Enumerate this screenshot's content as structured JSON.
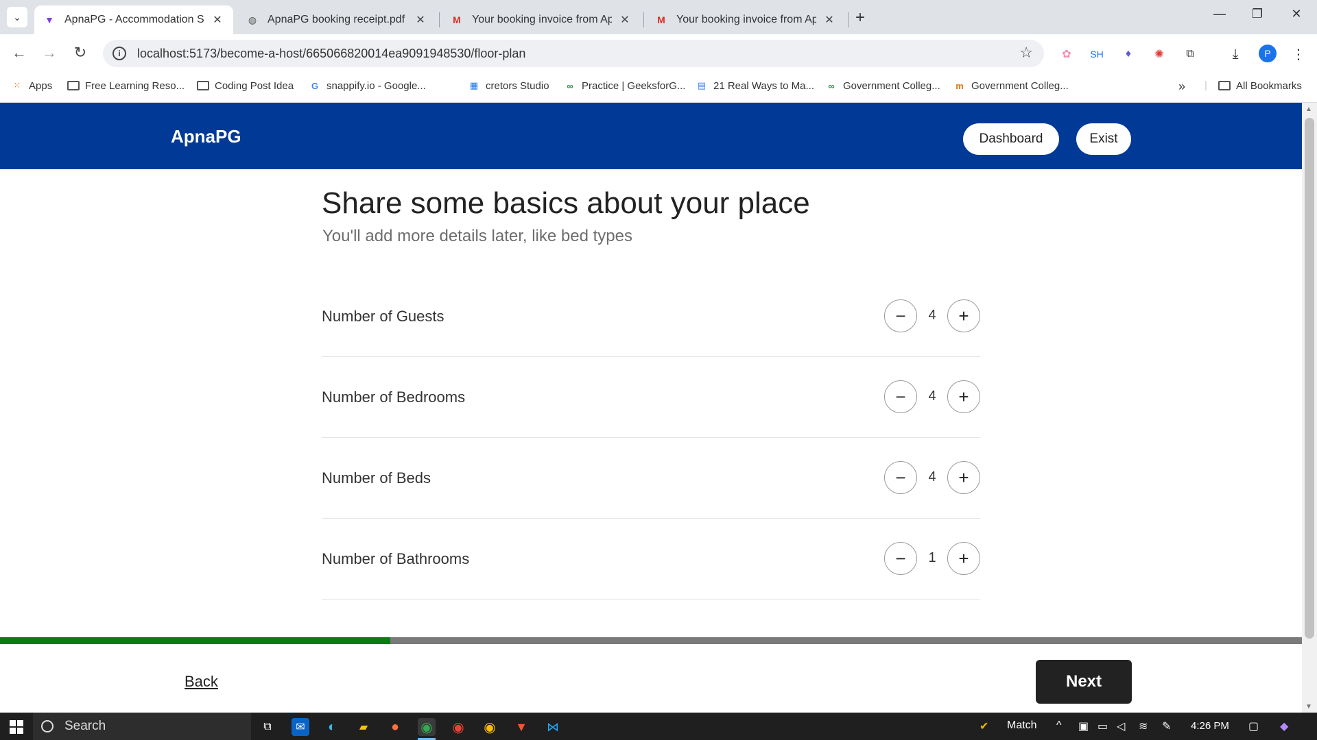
{
  "browser": {
    "tabs": [
      {
        "title": "ApnaPG - Accommodation Solu",
        "favicon": "apnapg-favicon",
        "active": true
      },
      {
        "title": "ApnaPG booking receipt.pdf",
        "favicon": "globe-icon",
        "active": false
      },
      {
        "title": "Your booking invoice from Apn",
        "favicon": "gmail-icon",
        "active": false
      },
      {
        "title": "Your booking invoice from Apn",
        "favicon": "gmail-icon",
        "active": false
      }
    ],
    "tab_close_glyph": "✕",
    "url": "localhost:5173/become-a-host/665066820014ea9091948530/floor-plan",
    "extension_sh": "SH",
    "profile_initial": "P",
    "bookmarks": [
      {
        "label": "Apps",
        "icon": "apps-grid-icon"
      },
      {
        "label": "Free Learning Reso...",
        "icon": "folder-icon"
      },
      {
        "label": "Coding Post Idea",
        "icon": "folder-icon"
      },
      {
        "label": "snappify.io - Google...",
        "icon": "google-icon"
      },
      {
        "label": "cretors Studio",
        "icon": "calendar-icon"
      },
      {
        "label": "Practice | GeeksforG...",
        "icon": "gfg-icon"
      },
      {
        "label": "21 Real Ways to Ma...",
        "icon": "doc-icon"
      },
      {
        "label": "Government Colleg...",
        "icon": "gfg-icon"
      },
      {
        "label": "Government Colleg...",
        "icon": "mn-icon"
      }
    ],
    "all_bookmarks": "All Bookmarks"
  },
  "header": {
    "logo": "ApnaPG",
    "dashboard_label": "Dashboard",
    "exist_label": "Exist",
    "bg_color": "#003a96"
  },
  "main": {
    "title": "Share some basics about your place",
    "subtitle": "You'll add more details later, like bed types",
    "counters": [
      {
        "label": "Number of Guests",
        "value": "4"
      },
      {
        "label": "Number of Bedrooms",
        "value": "4"
      },
      {
        "label": "Number of Beds",
        "value": "4"
      },
      {
        "label": "Number of Bathrooms",
        "value": "1"
      }
    ],
    "minus_glyph": "−",
    "plus_glyph": "+"
  },
  "footer": {
    "progress_fraction": 0.3,
    "progress_color": "#0a7d12",
    "back_label": "Back",
    "next_label": "Next"
  },
  "taskbar": {
    "search_label": "Search",
    "tray_app": "Match",
    "time": "4:26 PM"
  }
}
